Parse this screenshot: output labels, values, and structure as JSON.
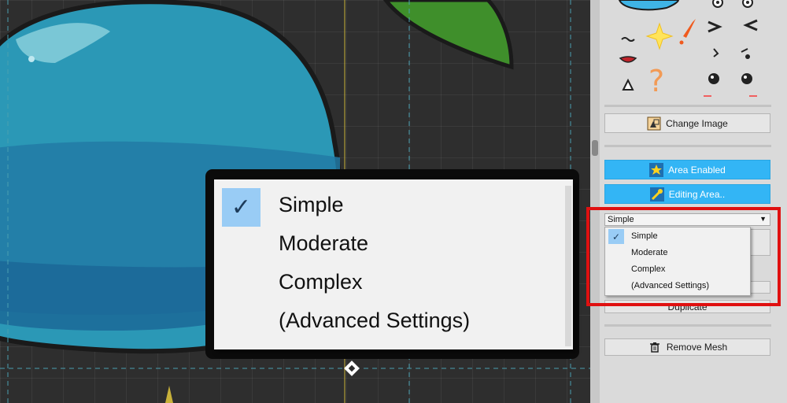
{
  "panel": {
    "change_image_label": "Change Image",
    "area_enabled_label": "Area Enabled",
    "editing_area_label": "Editing Area..",
    "duplicate_label": "Duplicate",
    "remove_mesh_label": "Remove Mesh"
  },
  "dropdown": {
    "selected": "Simple",
    "options": [
      "Simple",
      "Moderate",
      "Complex",
      "(Advanced Settings)"
    ]
  },
  "colors": {
    "accent_blue": "#33b5f5",
    "highlight_red": "#e01010",
    "check_bg": "#99ccf5"
  }
}
